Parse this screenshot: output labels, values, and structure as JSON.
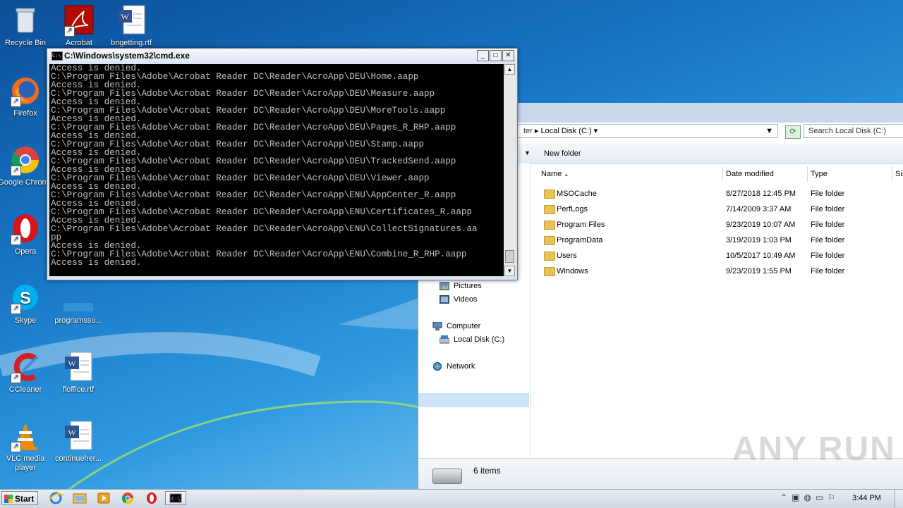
{
  "desktop": {
    "icons": [
      {
        "label": "Recycle Bin",
        "icon": "recycle-bin-icon"
      },
      {
        "label": "Acrobat",
        "icon": "acrobat-icon"
      },
      {
        "label": "bngetting.rtf",
        "icon": "word-document-icon"
      },
      {
        "label": "Firefox",
        "icon": "firefox-icon"
      },
      {
        "label": "Google Chrome",
        "icon": "chrome-icon"
      },
      {
        "label": "Opera",
        "icon": "opera-icon"
      },
      {
        "label": "Skype",
        "icon": "skype-icon"
      },
      {
        "label": "programssu...",
        "icon": "blank-file-icon"
      },
      {
        "label": "CCleaner",
        "icon": "ccleaner-icon"
      },
      {
        "label": "floffice.rtf",
        "icon": "word-document-icon"
      },
      {
        "label": "VLC media player",
        "icon": "vlc-icon"
      },
      {
        "label": "continueher...",
        "icon": "word-document-icon"
      }
    ]
  },
  "cmd": {
    "title": "C:\\Windows\\system32\\cmd.exe",
    "lines": [
      "Access is denied.",
      "C:\\Program Files\\Adobe\\Acrobat Reader DC\\Reader\\AcroApp\\DEU\\Home.aapp",
      "Access is denied.",
      "C:\\Program Files\\Adobe\\Acrobat Reader DC\\Reader\\AcroApp\\DEU\\Measure.aapp",
      "Access is denied.",
      "C:\\Program Files\\Adobe\\Acrobat Reader DC\\Reader\\AcroApp\\DEU\\MoreTools.aapp",
      "Access is denied.",
      "C:\\Program Files\\Adobe\\Acrobat Reader DC\\Reader\\AcroApp\\DEU\\Pages_R_RHP.aapp",
      "Access is denied.",
      "C:\\Program Files\\Adobe\\Acrobat Reader DC\\Reader\\AcroApp\\DEU\\Stamp.aapp",
      "Access is denied.",
      "C:\\Program Files\\Adobe\\Acrobat Reader DC\\Reader\\AcroApp\\DEU\\TrackedSend.aapp",
      "Access is denied.",
      "C:\\Program Files\\Adobe\\Acrobat Reader DC\\Reader\\AcroApp\\DEU\\Viewer.aapp",
      "Access is denied.",
      "C:\\Program Files\\Adobe\\Acrobat Reader DC\\Reader\\AcroApp\\ENU\\AppCenter_R.aapp",
      "Access is denied.",
      "C:\\Program Files\\Adobe\\Acrobat Reader DC\\Reader\\AcroApp\\ENU\\Certificates_R.aapp",
      "Access is denied.",
      "C:\\Program Files\\Adobe\\Acrobat Reader DC\\Reader\\AcroApp\\ENU\\CollectSignatures.aa",
      "pp",
      "Access is denied.",
      "C:\\Program Files\\Adobe\\Acrobat Reader DC\\Reader\\AcroApp\\ENU\\Combine_R_RHP.aapp",
      "Access is denied."
    ]
  },
  "explorer": {
    "address_partial": "ter",
    "address_location": "Local Disk (C:)",
    "search_placeholder": "Search Local Disk (C:)",
    "new_folder_label": "New folder",
    "columns": {
      "name": "Name",
      "date": "Date modified",
      "type": "Type",
      "size": "Siz"
    },
    "nav": [
      {
        "label": "Pictures",
        "icon": "pictures-icon"
      },
      {
        "label": "Videos",
        "icon": "videos-icon"
      },
      {
        "label": "Computer",
        "icon": "computer-icon"
      },
      {
        "label": "Local Disk (C:)",
        "icon": "local-disk-icon"
      },
      {
        "label": "Network",
        "icon": "network-icon"
      }
    ],
    "files": [
      {
        "name": "MSOCache",
        "date": "8/27/2018 12:45 PM",
        "type": "File folder"
      },
      {
        "name": "PerfLogs",
        "date": "7/14/2009 3:37 AM",
        "type": "File folder"
      },
      {
        "name": "Program Files",
        "date": "9/23/2019 10:07 AM",
        "type": "File folder"
      },
      {
        "name": "ProgramData",
        "date": "3/19/2019 1:03 PM",
        "type": "File folder"
      },
      {
        "name": "Users",
        "date": "10/5/2017 10:49 AM",
        "type": "File folder"
      },
      {
        "name": "Windows",
        "date": "9/23/2019 1:55 PM",
        "type": "File folder"
      }
    ],
    "status": "6 items"
  },
  "watermark": "ANY RUN",
  "taskbar": {
    "start_label": "Start",
    "clock": "3:44 PM"
  }
}
